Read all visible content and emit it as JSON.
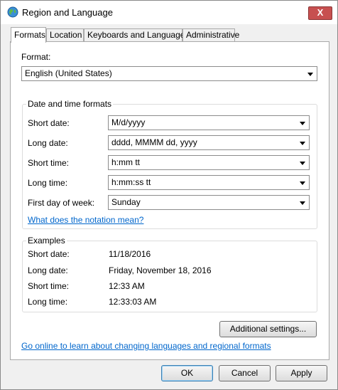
{
  "window": {
    "title": "Region and Language",
    "close_label": "X"
  },
  "tabs": [
    {
      "label": "Formats"
    },
    {
      "label": "Location"
    },
    {
      "label": "Keyboards and Languages"
    },
    {
      "label": "Administrative"
    }
  ],
  "format": {
    "label": "Format:",
    "value": "English (United States)"
  },
  "date_time_formats": {
    "title": "Date and time formats",
    "short_date_label": "Short date:",
    "short_date_value": "M/d/yyyy",
    "long_date_label": "Long date:",
    "long_date_value": "dddd, MMMM dd, yyyy",
    "short_time_label": "Short time:",
    "short_time_value": "h:mm tt",
    "long_time_label": "Long time:",
    "long_time_value": "h:mm:ss tt",
    "first_day_label": "First day of week:",
    "first_day_value": "Sunday",
    "notation_link": "What does the notation mean?"
  },
  "examples": {
    "title": "Examples",
    "short_date_label": "Short date:",
    "short_date_value": "11/18/2016",
    "long_date_label": "Long date:",
    "long_date_value": "Friday, November 18, 2016",
    "short_time_label": "Short time:",
    "short_time_value": "12:33 AM",
    "long_time_label": "Long time:",
    "long_time_value": "12:33:03 AM"
  },
  "additional_settings_label": "Additional settings...",
  "online_link": "Go online to learn about changing languages and regional formats",
  "buttons": {
    "ok": "OK",
    "cancel": "Cancel",
    "apply": "Apply"
  }
}
